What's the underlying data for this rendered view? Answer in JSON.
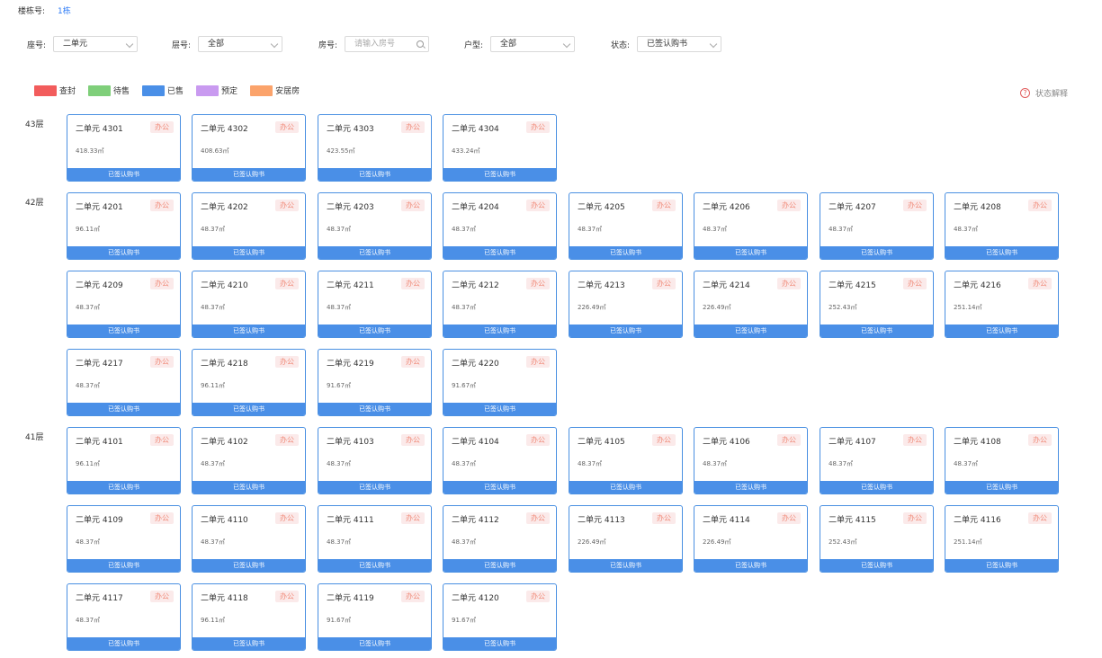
{
  "building": {
    "label": "楼栋号:",
    "value": "1栋"
  },
  "filters": {
    "seat": {
      "label": "座号:",
      "value": "二单元"
    },
    "floor": {
      "label": "层号:",
      "value": "全部"
    },
    "room": {
      "label": "房号:",
      "placeholder": "请输入房号"
    },
    "layout": {
      "label": "户型:",
      "value": "全部"
    },
    "status": {
      "label": "状态:",
      "value": "已签认购书"
    }
  },
  "legend": [
    {
      "label": "查封",
      "color": "#f25c5c"
    },
    {
      "label": "待售",
      "color": "#7fcf7a"
    },
    {
      "label": "已售",
      "color": "#4a8fe7"
    },
    {
      "label": "预定",
      "color": "#c99af0"
    },
    {
      "label": "安居房",
      "color": "#fba36b"
    }
  ],
  "help_label": "状态解释",
  "floors": [
    {
      "label": "43层",
      "rooms": [
        {
          "name": "二单元 4301",
          "tag": "办公",
          "area": "418.33㎡",
          "status": "已签认购书"
        },
        {
          "name": "二单元 4302",
          "tag": "办公",
          "area": "408.63㎡",
          "status": "已签认购书"
        },
        {
          "name": "二单元 4303",
          "tag": "办公",
          "area": "423.55㎡",
          "status": "已签认购书"
        },
        {
          "name": "二单元 4304",
          "tag": "办公",
          "area": "433.24㎡",
          "status": "已签认购书"
        }
      ]
    },
    {
      "label": "42层",
      "rooms": [
        {
          "name": "二单元 4201",
          "tag": "办公",
          "area": "96.11㎡",
          "status": "已签认购书"
        },
        {
          "name": "二单元 4202",
          "tag": "办公",
          "area": "48.37㎡",
          "status": "已签认购书"
        },
        {
          "name": "二单元 4203",
          "tag": "办公",
          "area": "48.37㎡",
          "status": "已签认购书"
        },
        {
          "name": "二单元 4204",
          "tag": "办公",
          "area": "48.37㎡",
          "status": "已签认购书"
        },
        {
          "name": "二单元 4205",
          "tag": "办公",
          "area": "48.37㎡",
          "status": "已签认购书"
        },
        {
          "name": "二单元 4206",
          "tag": "办公",
          "area": "48.37㎡",
          "status": "已签认购书"
        },
        {
          "name": "二单元 4207",
          "tag": "办公",
          "area": "48.37㎡",
          "status": "已签认购书"
        },
        {
          "name": "二单元 4208",
          "tag": "办公",
          "area": "48.37㎡",
          "status": "已签认购书"
        },
        {
          "name": "二单元 4209",
          "tag": "办公",
          "area": "48.37㎡",
          "status": "已签认购书"
        },
        {
          "name": "二单元 4210",
          "tag": "办公",
          "area": "48.37㎡",
          "status": "已签认购书"
        },
        {
          "name": "二单元 4211",
          "tag": "办公",
          "area": "48.37㎡",
          "status": "已签认购书"
        },
        {
          "name": "二单元 4212",
          "tag": "办公",
          "area": "48.37㎡",
          "status": "已签认购书"
        },
        {
          "name": "二单元 4213",
          "tag": "办公",
          "area": "226.49㎡",
          "status": "已签认购书"
        },
        {
          "name": "二单元 4214",
          "tag": "办公",
          "area": "226.49㎡",
          "status": "已签认购书"
        },
        {
          "name": "二单元 4215",
          "tag": "办公",
          "area": "252.43㎡",
          "status": "已签认购书"
        },
        {
          "name": "二单元 4216",
          "tag": "办公",
          "area": "251.14㎡",
          "status": "已签认购书"
        },
        {
          "name": "二单元 4217",
          "tag": "办公",
          "area": "48.37㎡",
          "status": "已签认购书"
        },
        {
          "name": "二单元 4218",
          "tag": "办公",
          "area": "96.11㎡",
          "status": "已签认购书"
        },
        {
          "name": "二单元 4219",
          "tag": "办公",
          "area": "91.67㎡",
          "status": "已签认购书"
        },
        {
          "name": "二单元 4220",
          "tag": "办公",
          "area": "91.67㎡",
          "status": "已签认购书"
        }
      ]
    },
    {
      "label": "41层",
      "rooms": [
        {
          "name": "二单元 4101",
          "tag": "办公",
          "area": "96.11㎡",
          "status": "已签认购书"
        },
        {
          "name": "二单元 4102",
          "tag": "办公",
          "area": "48.37㎡",
          "status": "已签认购书"
        },
        {
          "name": "二单元 4103",
          "tag": "办公",
          "area": "48.37㎡",
          "status": "已签认购书"
        },
        {
          "name": "二单元 4104",
          "tag": "办公",
          "area": "48.37㎡",
          "status": "已签认购书"
        },
        {
          "name": "二单元 4105",
          "tag": "办公",
          "area": "48.37㎡",
          "status": "已签认购书"
        },
        {
          "name": "二单元 4106",
          "tag": "办公",
          "area": "48.37㎡",
          "status": "已签认购书"
        },
        {
          "name": "二单元 4107",
          "tag": "办公",
          "area": "48.37㎡",
          "status": "已签认购书"
        },
        {
          "name": "二单元 4108",
          "tag": "办公",
          "area": "48.37㎡",
          "status": "已签认购书"
        },
        {
          "name": "二单元 4109",
          "tag": "办公",
          "area": "48.37㎡",
          "status": "已签认购书"
        },
        {
          "name": "二单元 4110",
          "tag": "办公",
          "area": "48.37㎡",
          "status": "已签认购书"
        },
        {
          "name": "二单元 4111",
          "tag": "办公",
          "area": "48.37㎡",
          "status": "已签认购书"
        },
        {
          "name": "二单元 4112",
          "tag": "办公",
          "area": "48.37㎡",
          "status": "已签认购书"
        },
        {
          "name": "二单元 4113",
          "tag": "办公",
          "area": "226.49㎡",
          "status": "已签认购书"
        },
        {
          "name": "二单元 4114",
          "tag": "办公",
          "area": "226.49㎡",
          "status": "已签认购书"
        },
        {
          "name": "二单元 4115",
          "tag": "办公",
          "area": "252.43㎡",
          "status": "已签认购书"
        },
        {
          "name": "二单元 4116",
          "tag": "办公",
          "area": "251.14㎡",
          "status": "已签认购书"
        },
        {
          "name": "二单元 4117",
          "tag": "办公",
          "area": "48.37㎡",
          "status": "已签认购书"
        },
        {
          "name": "二单元 4118",
          "tag": "办公",
          "area": "96.11㎡",
          "status": "已签认购书"
        },
        {
          "name": "二单元 4119",
          "tag": "办公",
          "area": "91.67㎡",
          "status": "已签认购书"
        },
        {
          "name": "二单元 4120",
          "tag": "办公",
          "area": "91.67㎡",
          "status": "已签认购书"
        }
      ]
    }
  ]
}
